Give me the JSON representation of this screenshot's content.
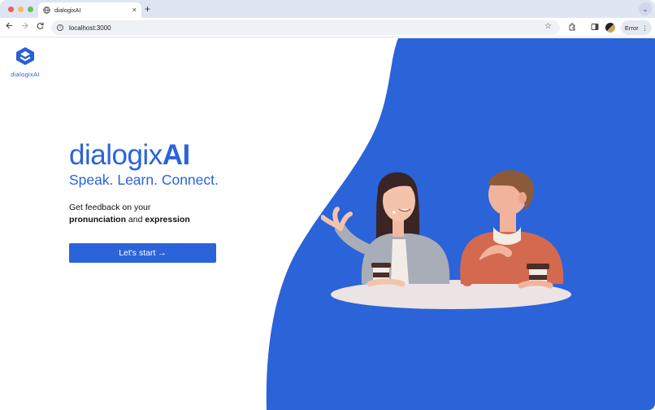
{
  "browser": {
    "tab_title": "dialogixAI",
    "tab_close": "×",
    "new_tab": "+",
    "tab_menu": "⌄",
    "url": "localhost:3000",
    "error_label": "Error",
    "error_menu": "⋮"
  },
  "brand": {
    "logo_text": "dialogixAI",
    "name_regular": "dialogix",
    "name_bold": "AI"
  },
  "hero": {
    "tagline": "Speak. Learn. Connect.",
    "desc_line1": "Get feedback on your",
    "desc_bold1": "pronunciation",
    "desc_mid": " and ",
    "desc_bold2": "expression",
    "cta_label": "Let's start →"
  },
  "colors": {
    "brand_blue": "#2b63d9",
    "tab_strip": "#dfe5f3"
  }
}
